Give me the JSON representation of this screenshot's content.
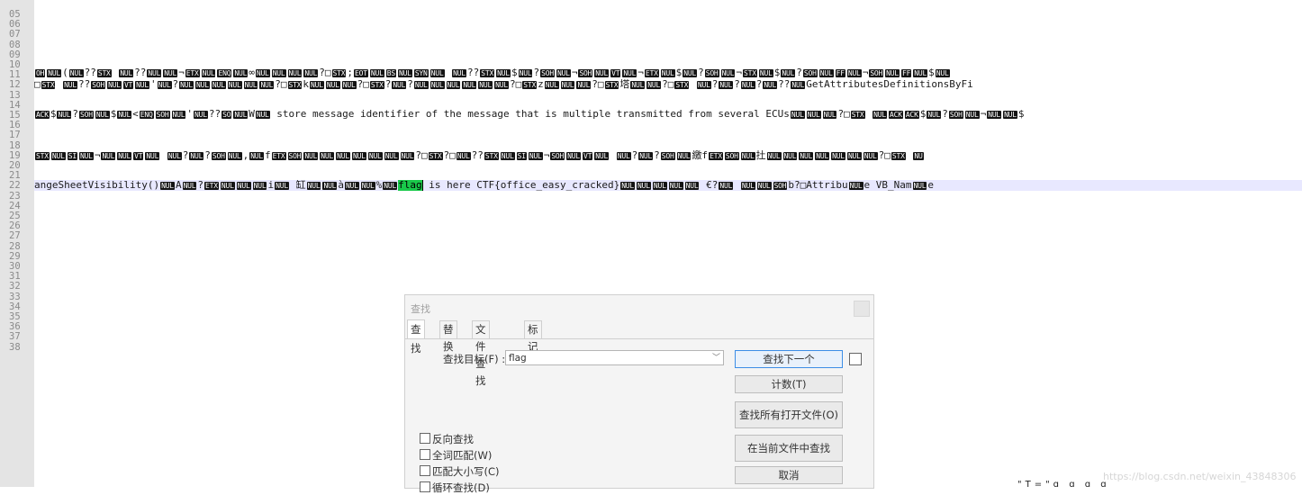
{
  "editor": {
    "line_numbers": [
      "05",
      "06",
      "07",
      "08",
      "09",
      "10",
      "11",
      "12",
      "13",
      "14",
      "15",
      "16",
      "17",
      "18",
      "19",
      "20",
      "21",
      "22",
      "23",
      "24",
      "25",
      "26",
      "27",
      "28",
      "29",
      "30",
      "31",
      "32",
      "33",
      "34",
      "35",
      "36",
      "37",
      "38"
    ],
    "line_09": {
      "segments": [
        {
          "t": "c",
          "v": "OH"
        },
        {
          "t": "c",
          "v": "NUL"
        },
        {
          "t": "x",
          "v": "("
        },
        {
          "t": "c",
          "v": "NUL"
        },
        {
          "t": "x",
          "v": "??"
        },
        {
          "t": "c",
          "v": "STX"
        },
        {
          "t": "x",
          "v": " "
        },
        {
          "t": "c",
          "v": "NUL"
        },
        {
          "t": "x",
          "v": "??"
        },
        {
          "t": "c",
          "v": "NUL"
        },
        {
          "t": "c",
          "v": "NUL"
        },
        {
          "t": "x",
          "v": "¬"
        },
        {
          "t": "c",
          "v": "ETX"
        },
        {
          "t": "c",
          "v": "NUL"
        },
        {
          "t": "c",
          "v": "ENQ"
        },
        {
          "t": "c",
          "v": "NUL"
        },
        {
          "t": "x",
          "v": "∞"
        },
        {
          "t": "c",
          "v": "NUL"
        },
        {
          "t": "c",
          "v": "NUL"
        },
        {
          "t": "c",
          "v": "NUL"
        },
        {
          "t": "c",
          "v": "NUL"
        },
        {
          "t": "x",
          "v": "?□"
        },
        {
          "t": "c",
          "v": "STX"
        },
        {
          "t": "x",
          "v": ";"
        },
        {
          "t": "c",
          "v": "EOT"
        },
        {
          "t": "c",
          "v": "NUL"
        },
        {
          "t": "c",
          "v": "BS"
        },
        {
          "t": "c",
          "v": "NUL"
        },
        {
          "t": "c",
          "v": "SYN"
        },
        {
          "t": "c",
          "v": "NUL"
        },
        {
          "t": "x",
          "v": " "
        },
        {
          "t": "c",
          "v": "NUL"
        },
        {
          "t": "x",
          "v": "??"
        },
        {
          "t": "c",
          "v": "STX"
        },
        {
          "t": "c",
          "v": "NUL"
        },
        {
          "t": "x",
          "v": "$"
        },
        {
          "t": "c",
          "v": "NUL"
        },
        {
          "t": "x",
          "v": "?"
        },
        {
          "t": "c",
          "v": "SOH"
        },
        {
          "t": "c",
          "v": "NUL"
        },
        {
          "t": "x",
          "v": "¬"
        },
        {
          "t": "c",
          "v": "SOH"
        },
        {
          "t": "c",
          "v": "NUL"
        },
        {
          "t": "c",
          "v": "VT"
        },
        {
          "t": "c",
          "v": "NUL"
        },
        {
          "t": "x",
          "v": "¬"
        },
        {
          "t": "c",
          "v": "ETX"
        },
        {
          "t": "c",
          "v": "NUL"
        },
        {
          "t": "x",
          "v": "$"
        },
        {
          "t": "c",
          "v": "NUL"
        },
        {
          "t": "x",
          "v": "?"
        },
        {
          "t": "c",
          "v": "SOH"
        },
        {
          "t": "c",
          "v": "NUL"
        },
        {
          "t": "x",
          "v": "¬"
        },
        {
          "t": "c",
          "v": "STX"
        },
        {
          "t": "c",
          "v": "NUL"
        },
        {
          "t": "x",
          "v": "$"
        },
        {
          "t": "c",
          "v": "NUL"
        },
        {
          "t": "x",
          "v": "?"
        },
        {
          "t": "c",
          "v": "SOH"
        },
        {
          "t": "c",
          "v": "NUL"
        },
        {
          "t": "c",
          "v": "FF"
        },
        {
          "t": "c",
          "v": "NUL"
        },
        {
          "t": "x",
          "v": "¬"
        },
        {
          "t": "c",
          "v": "SOH"
        },
        {
          "t": "c",
          "v": "NUL"
        },
        {
          "t": "c",
          "v": "FF"
        },
        {
          "t": "c",
          "v": "NUL"
        },
        {
          "t": "x",
          "v": "$"
        },
        {
          "t": "c",
          "v": "NUL"
        }
      ]
    },
    "line_10": {
      "segments": [
        {
          "t": "x",
          "v": "□"
        },
        {
          "t": "c",
          "v": "STX"
        },
        {
          "t": "x",
          "v": " "
        },
        {
          "t": "c",
          "v": "NUL"
        },
        {
          "t": "x",
          "v": "??"
        },
        {
          "t": "c",
          "v": "SOH"
        },
        {
          "t": "c",
          "v": "NUL"
        },
        {
          "t": "c",
          "v": "VT"
        },
        {
          "t": "c",
          "v": "NUL"
        },
        {
          "t": "x",
          "v": "'"
        },
        {
          "t": "c",
          "v": "NUL"
        },
        {
          "t": "x",
          "v": "?"
        },
        {
          "t": "c",
          "v": "NUL"
        },
        {
          "t": "c",
          "v": "NUL"
        },
        {
          "t": "c",
          "v": "NUL"
        },
        {
          "t": "c",
          "v": "NUL"
        },
        {
          "t": "c",
          "v": "NUL"
        },
        {
          "t": "c",
          "v": "NUL"
        },
        {
          "t": "x",
          "v": "?□"
        },
        {
          "t": "c",
          "v": "STX"
        },
        {
          "t": "x",
          "v": "k"
        },
        {
          "t": "c",
          "v": "NUL"
        },
        {
          "t": "c",
          "v": "NUL"
        },
        {
          "t": "c",
          "v": "NUL"
        },
        {
          "t": "x",
          "v": "?□"
        },
        {
          "t": "c",
          "v": "STX"
        },
        {
          "t": "x",
          "v": "?"
        },
        {
          "t": "c",
          "v": "NUL"
        },
        {
          "t": "x",
          "v": "?"
        },
        {
          "t": "c",
          "v": "NUL"
        },
        {
          "t": "c",
          "v": "NUL"
        },
        {
          "t": "c",
          "v": "NUL"
        },
        {
          "t": "c",
          "v": "NUL"
        },
        {
          "t": "c",
          "v": "NUL"
        },
        {
          "t": "c",
          "v": "NUL"
        },
        {
          "t": "x",
          "v": "?□"
        },
        {
          "t": "c",
          "v": "STX"
        },
        {
          "t": "x",
          "v": "z"
        },
        {
          "t": "c",
          "v": "NUL"
        },
        {
          "t": "c",
          "v": "NUL"
        },
        {
          "t": "c",
          "v": "NUL"
        },
        {
          "t": "x",
          "v": "?□"
        },
        {
          "t": "c",
          "v": "STX"
        },
        {
          "t": "x",
          "v": "塔"
        },
        {
          "t": "c",
          "v": "NUL"
        },
        {
          "t": "c",
          "v": "NUL"
        },
        {
          "t": "x",
          "v": "?□"
        },
        {
          "t": "c",
          "v": "STX"
        },
        {
          "t": "x",
          "v": " "
        },
        {
          "t": "c",
          "v": "NUL"
        },
        {
          "t": "x",
          "v": "?"
        },
        {
          "t": "c",
          "v": "NUL"
        },
        {
          "t": "x",
          "v": "?"
        },
        {
          "t": "c",
          "v": "NUL"
        },
        {
          "t": "x",
          "v": "?"
        },
        {
          "t": "c",
          "v": "NUL"
        },
        {
          "t": "x",
          "v": "??"
        },
        {
          "t": "c",
          "v": "NUL"
        },
        {
          "t": "x",
          "v": "GetAttributesDefinitionsByFi"
        }
      ]
    },
    "line_12": {
      "segments": [
        {
          "t": "c",
          "v": "ACK"
        },
        {
          "t": "x",
          "v": "$"
        },
        {
          "t": "c",
          "v": "NUL"
        },
        {
          "t": "x",
          "v": "?"
        },
        {
          "t": "c",
          "v": "SOH"
        },
        {
          "t": "c",
          "v": "NUL"
        },
        {
          "t": "x",
          "v": "$"
        },
        {
          "t": "c",
          "v": "NUL"
        },
        {
          "t": "x",
          "v": "<"
        },
        {
          "t": "c",
          "v": "ENQ"
        },
        {
          "t": "c",
          "v": "SOH"
        },
        {
          "t": "c",
          "v": "NUL"
        },
        {
          "t": "x",
          "v": "'"
        },
        {
          "t": "c",
          "v": "NUL"
        },
        {
          "t": "x",
          "v": "??"
        },
        {
          "t": "c",
          "v": "SO"
        },
        {
          "t": "c",
          "v": "NUL"
        },
        {
          "t": "x",
          "v": "W"
        },
        {
          "t": "c",
          "v": "NUL"
        },
        {
          "t": "x",
          "v": " store message identifier of the message that is multiple transmitted from several ECUs"
        },
        {
          "t": "c",
          "v": "NUL"
        },
        {
          "t": "c",
          "v": "NUL"
        },
        {
          "t": "c",
          "v": "NUL"
        },
        {
          "t": "x",
          "v": "?□"
        },
        {
          "t": "c",
          "v": "STX"
        },
        {
          "t": "x",
          "v": " "
        },
        {
          "t": "c",
          "v": "NUL"
        },
        {
          "t": "c",
          "v": "ACK"
        },
        {
          "t": "c",
          "v": "ACK"
        },
        {
          "t": "x",
          "v": "$"
        },
        {
          "t": "c",
          "v": "NUL"
        },
        {
          "t": "x",
          "v": "?"
        },
        {
          "t": "c",
          "v": "SOH"
        },
        {
          "t": "c",
          "v": "NUL"
        },
        {
          "t": "x",
          "v": "¬"
        },
        {
          "t": "c",
          "v": "NUL"
        },
        {
          "t": "c",
          "v": "NUL"
        },
        {
          "t": "x",
          "v": "$"
        }
      ]
    },
    "line_15": {
      "segments": [
        {
          "t": "c",
          "v": "STX"
        },
        {
          "t": "c",
          "v": "NUL"
        },
        {
          "t": "c",
          "v": "SI"
        },
        {
          "t": "c",
          "v": "NUL"
        },
        {
          "t": "x",
          "v": "¬"
        },
        {
          "t": "c",
          "v": "NUL"
        },
        {
          "t": "c",
          "v": "NUL"
        },
        {
          "t": "c",
          "v": "VT"
        },
        {
          "t": "c",
          "v": "NUL"
        },
        {
          "t": "x",
          "v": " "
        },
        {
          "t": "c",
          "v": "NUL"
        },
        {
          "t": "x",
          "v": "?"
        },
        {
          "t": "c",
          "v": "NUL"
        },
        {
          "t": "x",
          "v": "?"
        },
        {
          "t": "c",
          "v": "SOH"
        },
        {
          "t": "c",
          "v": "NUL"
        },
        {
          "t": "x",
          "v": ","
        },
        {
          "t": "c",
          "v": "NUL"
        },
        {
          "t": "x",
          "v": "f"
        },
        {
          "t": "c",
          "v": "ETX"
        },
        {
          "t": "c",
          "v": "SOH"
        },
        {
          "t": "c",
          "v": "NUL"
        },
        {
          "t": "c",
          "v": "NUL"
        },
        {
          "t": "c",
          "v": "NUL"
        },
        {
          "t": "c",
          "v": "NUL"
        },
        {
          "t": "c",
          "v": "NUL"
        },
        {
          "t": "c",
          "v": "NUL"
        },
        {
          "t": "c",
          "v": "NUL"
        },
        {
          "t": "x",
          "v": "?□"
        },
        {
          "t": "c",
          "v": "STX"
        },
        {
          "t": "x",
          "v": "?□"
        },
        {
          "t": "c",
          "v": "NUL"
        },
        {
          "t": "x",
          "v": "??"
        },
        {
          "t": "c",
          "v": "STX"
        },
        {
          "t": "c",
          "v": "NUL"
        },
        {
          "t": "c",
          "v": "SI"
        },
        {
          "t": "c",
          "v": "NUL"
        },
        {
          "t": "x",
          "v": "¬"
        },
        {
          "t": "c",
          "v": "SOH"
        },
        {
          "t": "c",
          "v": "NUL"
        },
        {
          "t": "c",
          "v": "VT"
        },
        {
          "t": "c",
          "v": "NUL"
        },
        {
          "t": "x",
          "v": " "
        },
        {
          "t": "c",
          "v": "NUL"
        },
        {
          "t": "x",
          "v": "?"
        },
        {
          "t": "c",
          "v": "NUL"
        },
        {
          "t": "x",
          "v": "?"
        },
        {
          "t": "c",
          "v": "SOH"
        },
        {
          "t": "c",
          "v": "NUL"
        },
        {
          "t": "x",
          "v": "繳f"
        },
        {
          "t": "c",
          "v": "ETX"
        },
        {
          "t": "c",
          "v": "SOH"
        },
        {
          "t": "c",
          "v": "NUL"
        },
        {
          "t": "x",
          "v": "扗"
        },
        {
          "t": "c",
          "v": "NUL"
        },
        {
          "t": "c",
          "v": "NUL"
        },
        {
          "t": "c",
          "v": "NUL"
        },
        {
          "t": "c",
          "v": "NUL"
        },
        {
          "t": "c",
          "v": "NUL"
        },
        {
          "t": "c",
          "v": "NUL"
        },
        {
          "t": "c",
          "v": "NUL"
        },
        {
          "t": "x",
          "v": "?□"
        },
        {
          "t": "c",
          "v": "STX"
        },
        {
          "t": "x",
          "v": " "
        },
        {
          "t": "c",
          "v": "NU"
        }
      ]
    },
    "line_19": {
      "segments": [
        {
          "t": "x",
          "v": "angeSheetVisibility()"
        },
        {
          "t": "c",
          "v": "NUL"
        },
        {
          "t": "x",
          "v": "A"
        },
        {
          "t": "c",
          "v": "NUL"
        },
        {
          "t": "x",
          "v": "?"
        },
        {
          "t": "c",
          "v": "ETX"
        },
        {
          "t": "c",
          "v": "NUL"
        },
        {
          "t": "c",
          "v": "NUL"
        },
        {
          "t": "c",
          "v": "NUL"
        },
        {
          "t": "x",
          "v": "i"
        },
        {
          "t": "c",
          "v": "NUL"
        },
        {
          "t": "x",
          "v": "     缸"
        },
        {
          "t": "c",
          "v": "NUL"
        },
        {
          "t": "c",
          "v": "NUL"
        },
        {
          "t": "x",
          "v": "à"
        },
        {
          "t": "c",
          "v": "NUL"
        },
        {
          "t": "c",
          "v": "NUL"
        },
        {
          "t": "x",
          "v": "%"
        },
        {
          "t": "c",
          "v": "NUL"
        },
        {
          "t": "h",
          "v": "flag"
        },
        {
          "t": "caret",
          "v": ""
        },
        {
          "t": "x",
          "v": " is here CTF{office_easy_cracked}"
        },
        {
          "t": "c",
          "v": "NUL"
        },
        {
          "t": "c",
          "v": "NUL"
        },
        {
          "t": "c",
          "v": "NUL"
        },
        {
          "t": "c",
          "v": "NUL"
        },
        {
          "t": "c",
          "v": "NUL"
        },
        {
          "t": "x",
          "v": "         €?"
        },
        {
          "t": "c",
          "v": "NUL"
        },
        {
          "t": "x",
          "v": "          "
        },
        {
          "t": "c",
          "v": "NUL"
        },
        {
          "t": "c",
          "v": "NUL"
        },
        {
          "t": "c",
          "v": "SOH"
        },
        {
          "t": "x",
          "v": "b?□Attribu"
        },
        {
          "t": "c",
          "v": "NUL"
        },
        {
          "t": "x",
          "v": "e VB_Nam"
        },
        {
          "t": "c",
          "v": "NUL"
        },
        {
          "t": "x",
          "v": "e"
        }
      ]
    }
  },
  "find_dialog": {
    "title": "查找",
    "tabs": [
      "查找",
      "替换",
      "文件查找",
      "标记"
    ],
    "target_label": "查找目标(F) :",
    "target_value": "flag",
    "buttons": {
      "find_next": "查找下一个",
      "count": "计数(T)",
      "find_all_open": "查找所有打开文件(O)",
      "find_in_current": "在当前文件中查找",
      "cancel": "取消"
    },
    "options": {
      "reverse": "反向查找",
      "whole_word": "全词匹配(W)",
      "match_case": "匹配大小写(C)",
      "wrap": "循环查找(D)"
    }
  },
  "watermark": "https://blog.csdn.net/weixin_43848306",
  "bottom_scribble": "\"T=\"ɑ  ɑ   ɑ  ɑ"
}
